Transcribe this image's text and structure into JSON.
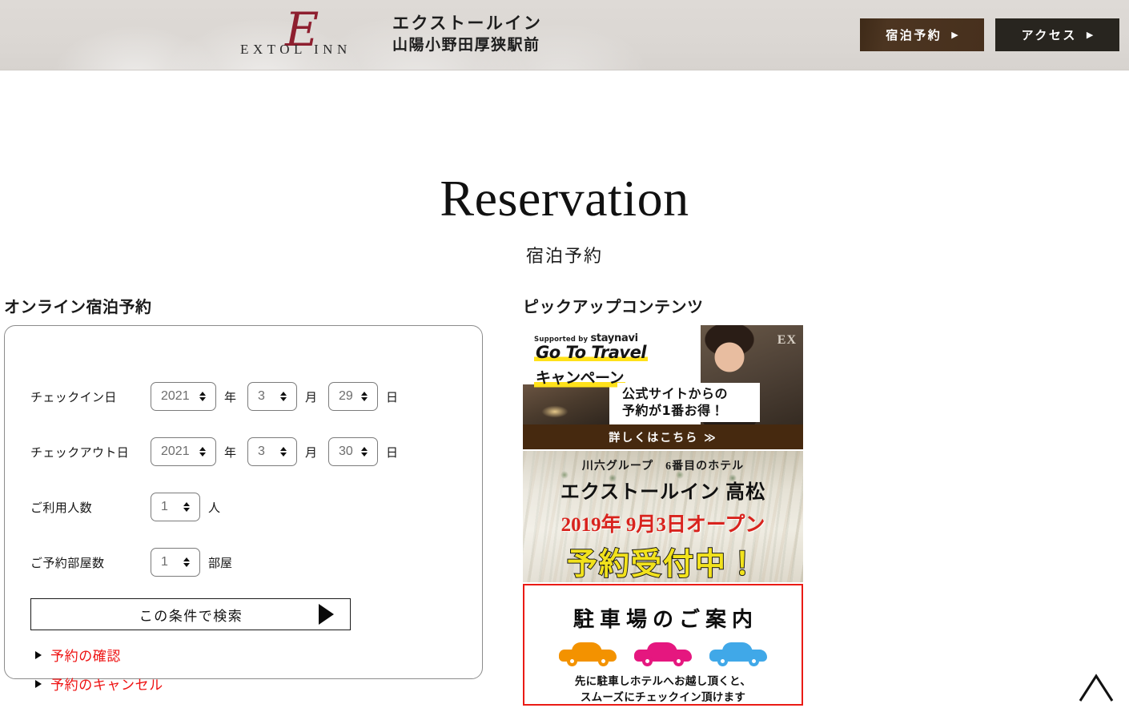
{
  "header": {
    "logo_monogram": "E",
    "logo_wordmark": "EXTOL INN",
    "brand_line1": "エクストールイン",
    "brand_line2": "山陽小野田厚狭駅前",
    "reserve_button": "宿泊予約",
    "access_button": "アクセス",
    "arrow_glyph": "▶",
    "reserve_button_color": "#4a3420",
    "access_button_color": "#28251f",
    "background_color": "#dbd7d3"
  },
  "page": {
    "title": "Reservation",
    "subtitle": "宿泊予約"
  },
  "booking": {
    "heading": "オンライン宿泊予約",
    "checkin": {
      "label": "チェックイン日",
      "year": "2021",
      "year_unit": "年",
      "month": "3",
      "month_unit": "月",
      "day": "29",
      "day_unit": "日"
    },
    "checkout": {
      "label": "チェックアウト日",
      "year": "2021",
      "year_unit": "年",
      "month": "3",
      "month_unit": "月",
      "day": "30",
      "day_unit": "日"
    },
    "guests": {
      "label": "ご利用人数",
      "value": "1",
      "unit": "人"
    },
    "rooms": {
      "label": "ご予約部屋数",
      "value": "1",
      "unit": "部屋"
    },
    "search_button": "この条件で検索",
    "links": [
      {
        "label": "予約の確認"
      },
      {
        "label": "予約のキャンセル"
      }
    ],
    "link_color": "#ee1111"
  },
  "pickup": {
    "heading": "ピックアップコンテンツ",
    "banners": [
      {
        "name": "staynavi-gototravel",
        "supported_by": "Supported by",
        "brand": "staynavi",
        "headline": "Go To Travel",
        "subhead": "キャンペーン",
        "message_line1": "公式サイトからの",
        "message_line2": "予約が1番お得！",
        "cta": "詳しくはこちら ≫",
        "highlight_color": "#ffe11a",
        "bar_color": "#46290f"
      },
      {
        "name": "extol-inn-takamatsu",
        "line1": "川六グループ　6番目のホテル",
        "line2": "エクストールイン 高松",
        "line3": "2019年 9月3日オープン",
        "line4": "予約受付中！",
        "line3_color": "#d8231d",
        "line4_color": "#f2e21c"
      },
      {
        "name": "parking-guide",
        "title": "駐車場のご案内",
        "note_line1": "先に駐車しホテルへお越し頂くと、",
        "note_line2": "スムーズにチェックイン頂けます",
        "border_color": "#ea1b15",
        "cars": [
          {
            "color": "#f39200",
            "name": "orange"
          },
          {
            "color": "#e5177f",
            "name": "pink"
          },
          {
            "color": "#40a8e8",
            "name": "blue"
          }
        ]
      }
    ]
  },
  "scroll_top": {
    "icon": "chevron-up"
  }
}
